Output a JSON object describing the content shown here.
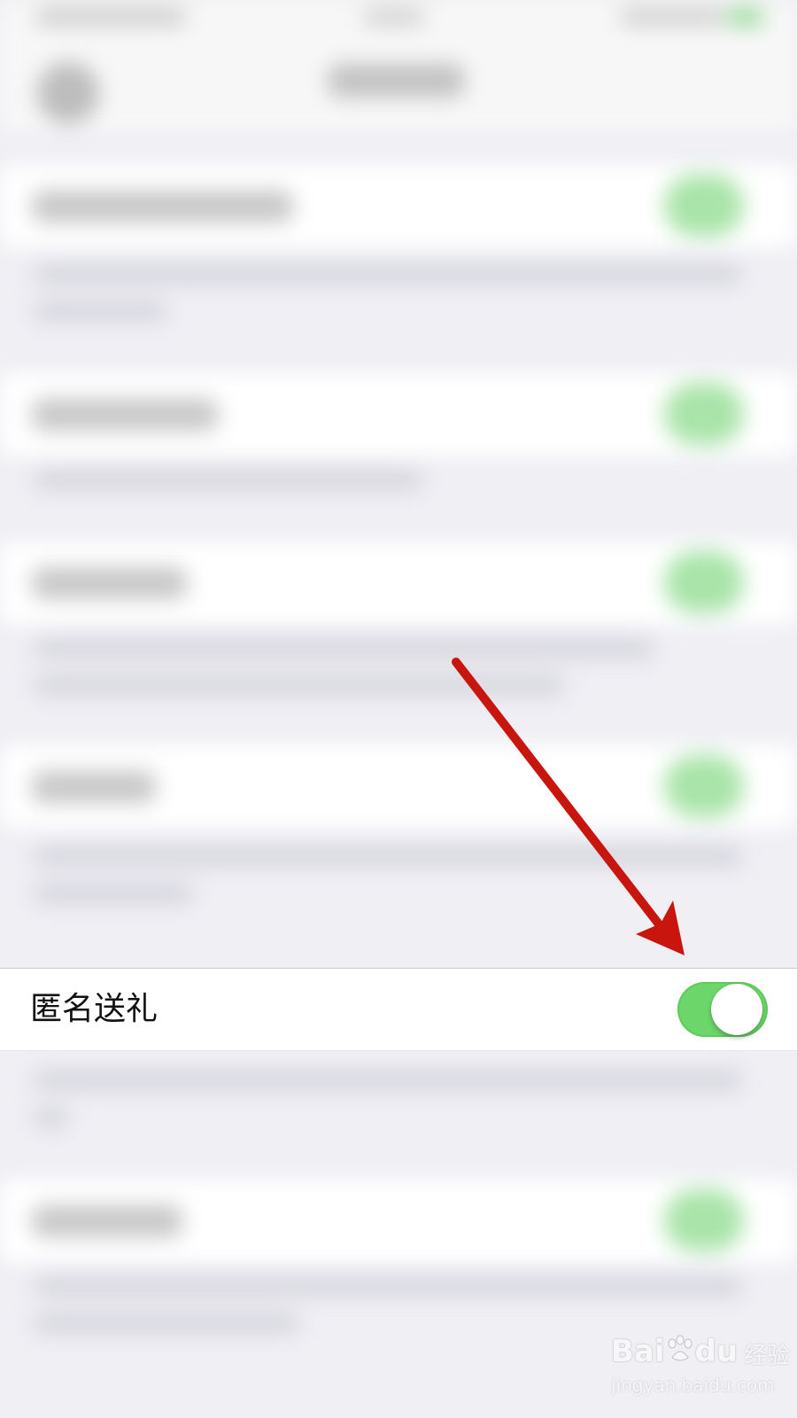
{
  "row": {
    "label": "匿名送礼",
    "toggle_state": "on"
  },
  "colors": {
    "toggle_on": "#6dd66a",
    "arrow": "#c8160f",
    "background": "#efeff4"
  },
  "watermark": {
    "brand": "Bai",
    "brand_suffix": "du",
    "sub": "经验",
    "url": "jingyan.baidu.com"
  }
}
